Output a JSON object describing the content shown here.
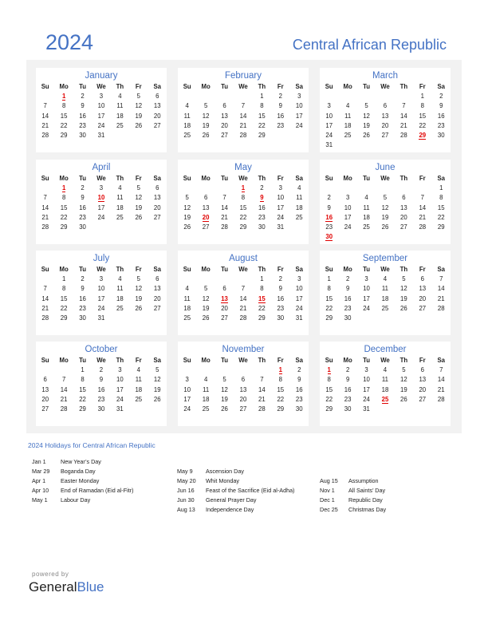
{
  "header": {
    "year": "2024",
    "country": "Central African Republic"
  },
  "weekdays": [
    "Su",
    "Mo",
    "Tu",
    "We",
    "Th",
    "Fr",
    "Sa"
  ],
  "months": [
    {
      "name": "January",
      "start": 1,
      "days": 31,
      "holidays": [
        1
      ]
    },
    {
      "name": "February",
      "start": 4,
      "days": 29,
      "holidays": []
    },
    {
      "name": "March",
      "start": 5,
      "days": 31,
      "holidays": [
        29
      ]
    },
    {
      "name": "April",
      "start": 1,
      "days": 30,
      "holidays": [
        1,
        10
      ]
    },
    {
      "name": "May",
      "start": 3,
      "days": 31,
      "holidays": [
        1,
        9,
        20
      ]
    },
    {
      "name": "June",
      "start": 6,
      "days": 30,
      "holidays": [
        16,
        30
      ]
    },
    {
      "name": "July",
      "start": 1,
      "days": 31,
      "holidays": []
    },
    {
      "name": "August",
      "start": 4,
      "days": 31,
      "holidays": [
        13,
        15
      ]
    },
    {
      "name": "September",
      "start": 0,
      "days": 30,
      "holidays": []
    },
    {
      "name": "October",
      "start": 2,
      "days": 31,
      "holidays": []
    },
    {
      "name": "November",
      "start": 5,
      "days": 30,
      "holidays": [
        1
      ]
    },
    {
      "name": "December",
      "start": 0,
      "days": 31,
      "holidays": [
        1,
        25
      ]
    }
  ],
  "holidays_title": "2024 Holidays for Central African Republic",
  "holiday_columns": [
    [
      {
        "date": "Jan 1",
        "name": "New Year’s Day"
      },
      {
        "date": "Mar 29",
        "name": "Boganda Day"
      },
      {
        "date": "Apr 1",
        "name": "Easter Monday"
      },
      {
        "date": "Apr 10",
        "name": "End of Ramadan (Eid al-Fitr)"
      },
      {
        "date": "May 1",
        "name": "Labour Day"
      }
    ],
    [
      {
        "date": "May 9",
        "name": "Ascension Day"
      },
      {
        "date": "May 20",
        "name": "Whit Monday"
      },
      {
        "date": "Jun 16",
        "name": "Feast of the Sacrifice (Eid al-Adha)"
      },
      {
        "date": "Jun 30",
        "name": "General Prayer Day"
      },
      {
        "date": "Aug 13",
        "name": "Independence Day"
      }
    ],
    [
      {
        "date": "Aug 15",
        "name": "Assumption"
      },
      {
        "date": "Nov 1",
        "name": "All Saints’ Day"
      },
      {
        "date": "Dec 1",
        "name": "Republic Day"
      },
      {
        "date": "Dec 25",
        "name": "Christmas Day"
      }
    ]
  ],
  "footer": {
    "powered": "powered by",
    "brand_a": "General",
    "brand_b": "Blue"
  }
}
